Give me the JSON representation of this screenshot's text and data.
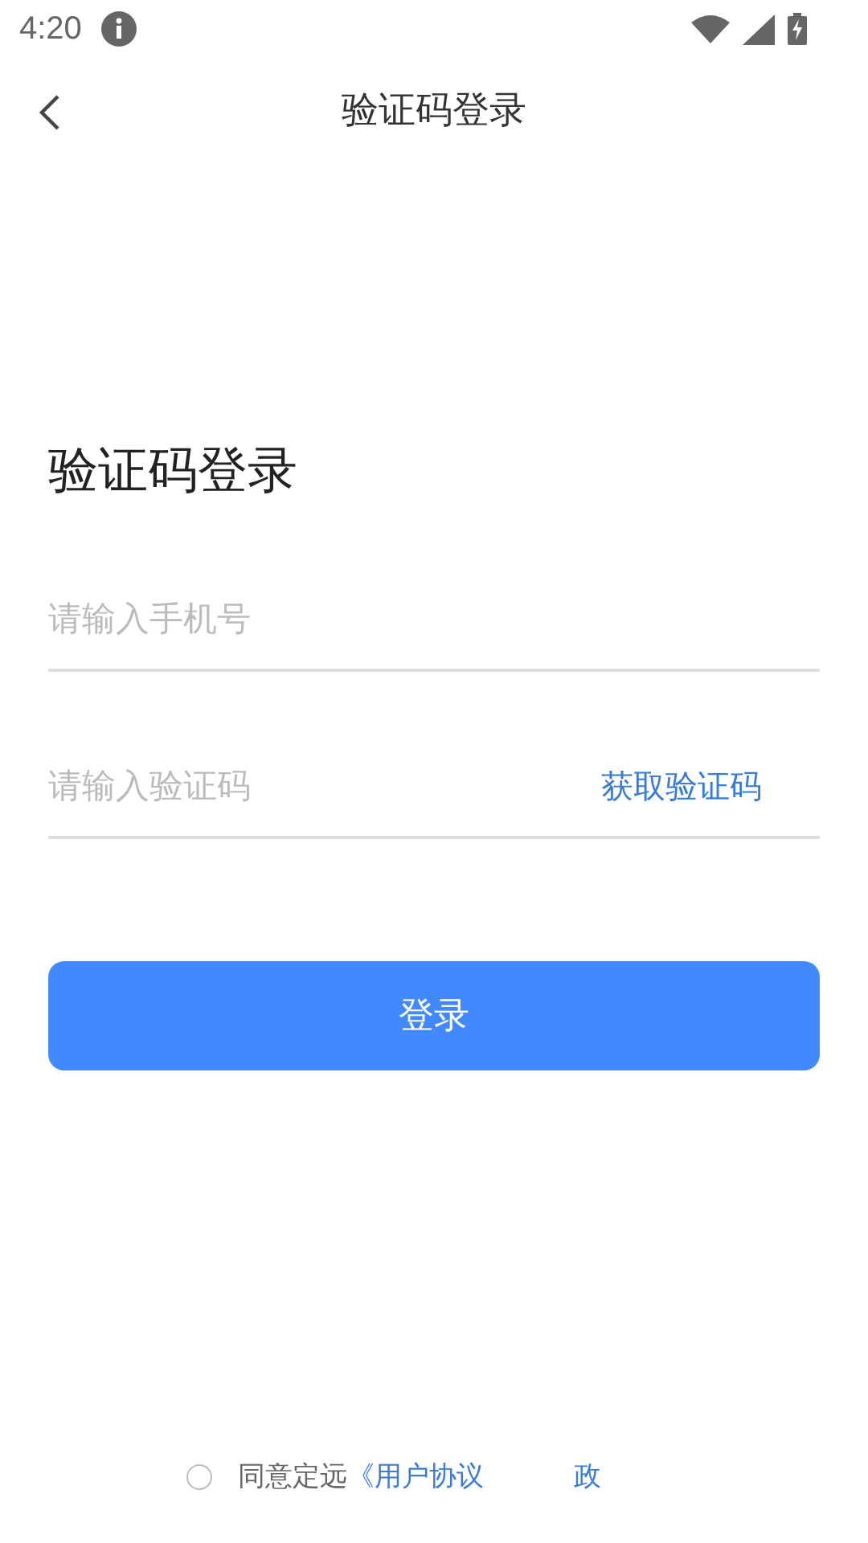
{
  "status_bar": {
    "time": "4:20"
  },
  "nav": {
    "title": "验证码登录"
  },
  "heading": "验证码登录",
  "phone_field": {
    "placeholder": "请输入手机号"
  },
  "code_field": {
    "placeholder": "请输入验证码",
    "action": "获取验证码"
  },
  "login_button": "登录",
  "agreement": {
    "checked": false,
    "text": "同意定远",
    "links": [
      "《用户协议",
      "政"
    ]
  }
}
